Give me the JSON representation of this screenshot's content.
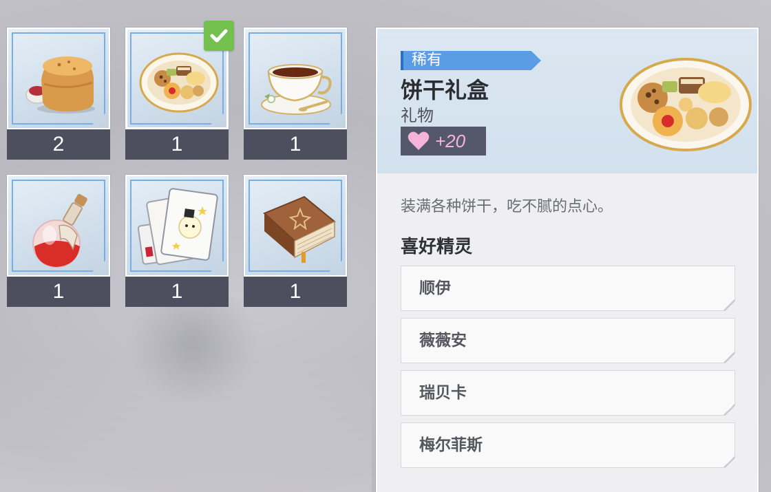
{
  "inventory": {
    "items": [
      {
        "name": "scone",
        "count": "2"
      },
      {
        "name": "cookie-gift-box",
        "count": "1",
        "selected": true
      },
      {
        "name": "teacup",
        "count": "1"
      },
      {
        "name": "potion",
        "count": "1"
      },
      {
        "name": "joker-cards",
        "count": "1"
      },
      {
        "name": "brown-book",
        "count": "1"
      }
    ]
  },
  "detail": {
    "rarity": "稀有",
    "title": "饼干礼盒",
    "type": "礼物",
    "affinity": "+20",
    "description": "装满各种饼干，吃不腻的点心。",
    "favorite_title": "喜好精灵",
    "favorites": [
      "顺伊",
      "薇薇安",
      "瑞贝卡",
      "梅尔菲斯"
    ]
  },
  "colors": {
    "rarity_blue": "#5b9de5",
    "check_green": "#73c04e",
    "count_bar": "#4d4f5e",
    "heart_pink": "#f6b4d8"
  },
  "icons": {
    "selected": "checkmark-icon",
    "affinity": "heart-icon"
  }
}
